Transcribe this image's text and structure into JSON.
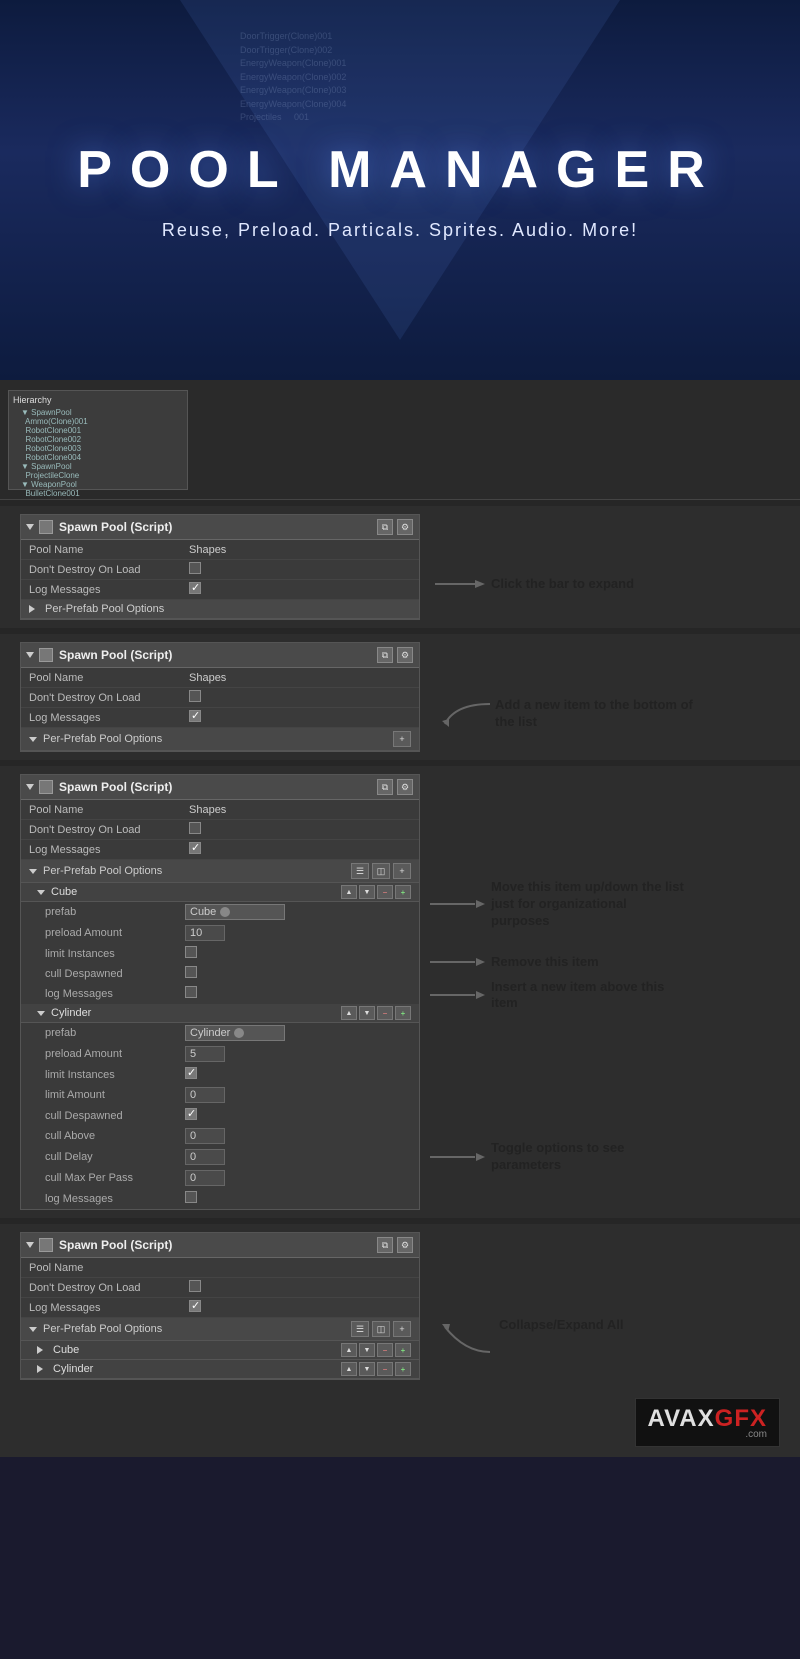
{
  "hero": {
    "title": "POOL MANAGER",
    "subtitle": "Reuse,  Preload.  Particals.  Sprites.  Audio.  More!",
    "bg_lines": [
      "DoorTrigger(Clone)001",
      "DoorTrigger(Clone)002",
      "EnergyWeapon(Clone)001",
      "EnergyWeapon(Clone)002",
      "EnergyWeapon(Clone)003",
      "EnergyWeapon(Clone)004",
      "Projectiles",
      "001"
    ]
  },
  "panels": {
    "panel1": {
      "title": "Spawn Pool (Script)",
      "pool_name_label": "Pool Name",
      "pool_name_value": "Shapes",
      "dont_destroy_label": "Don't Destroy On Load",
      "log_messages_label": "Log Messages",
      "per_prefab_label": "Per-Prefab Pool Options",
      "annotation": "Click the bar to expand"
    },
    "panel2": {
      "title": "Spawn Pool (Script)",
      "pool_name_label": "Pool Name",
      "pool_name_value": "Shapes",
      "dont_destroy_label": "Don't Destroy On Load",
      "log_messages_label": "Log Messages",
      "per_prefab_label": "Per-Prefab Pool Options",
      "annotation": "Add a new item to the bottom of the list"
    },
    "panel3": {
      "title": "Spawn Pool (Script)",
      "pool_name_label": "Pool Name",
      "pool_name_value": "Shapes",
      "dont_destroy_label": "Don't Destroy On Load",
      "log_messages_label": "Log Messages",
      "per_prefab_label": "Per-Prefab Pool Options",
      "cube": {
        "label": "Cube",
        "prefab_label": "prefab",
        "prefab_value": "Cube",
        "preload_label": "preload Amount",
        "preload_value": "10",
        "limit_instances_label": "limit Instances",
        "cull_despawned_label": "cull Despawned",
        "log_messages_label": "log Messages"
      },
      "cylinder": {
        "label": "Cylinder",
        "prefab_label": "prefab",
        "prefab_value": "Cylinder",
        "preload_label": "preload Amount",
        "preload_value": "5",
        "limit_instances_label": "limit Instances",
        "limit_amount_label": "limit Amount",
        "limit_amount_value": "0",
        "cull_despawned_label": "cull Despawned",
        "cull_above_label": "cull Above",
        "cull_above_value": "0",
        "cull_delay_label": "cull Delay",
        "cull_delay_value": "0",
        "cull_max_label": "cull Max Per Pass",
        "cull_max_value": "0",
        "log_messages_label": "log Messages"
      },
      "annotations": {
        "anno1": "Move this item up/down the list just for organizational purposes",
        "anno2": "Remove this item",
        "anno3": "Insert a new item above this item",
        "anno4": "Toggle options to see parameters"
      }
    },
    "panel4": {
      "title": "Spawn Pool (Script)",
      "pool_name_label": "Pool Name",
      "dont_destroy_label": "Don't Destroy On Load",
      "log_messages_label": "Log Messages",
      "per_prefab_label": "Per-Prefab Pool Options",
      "cube_label": "Cube",
      "cylinder_label": "Cylinder",
      "annotation": "Collapse/Expand All"
    }
  },
  "logo": {
    "avax": "AVAX",
    "gfx": "GFX",
    "com": ".com"
  }
}
